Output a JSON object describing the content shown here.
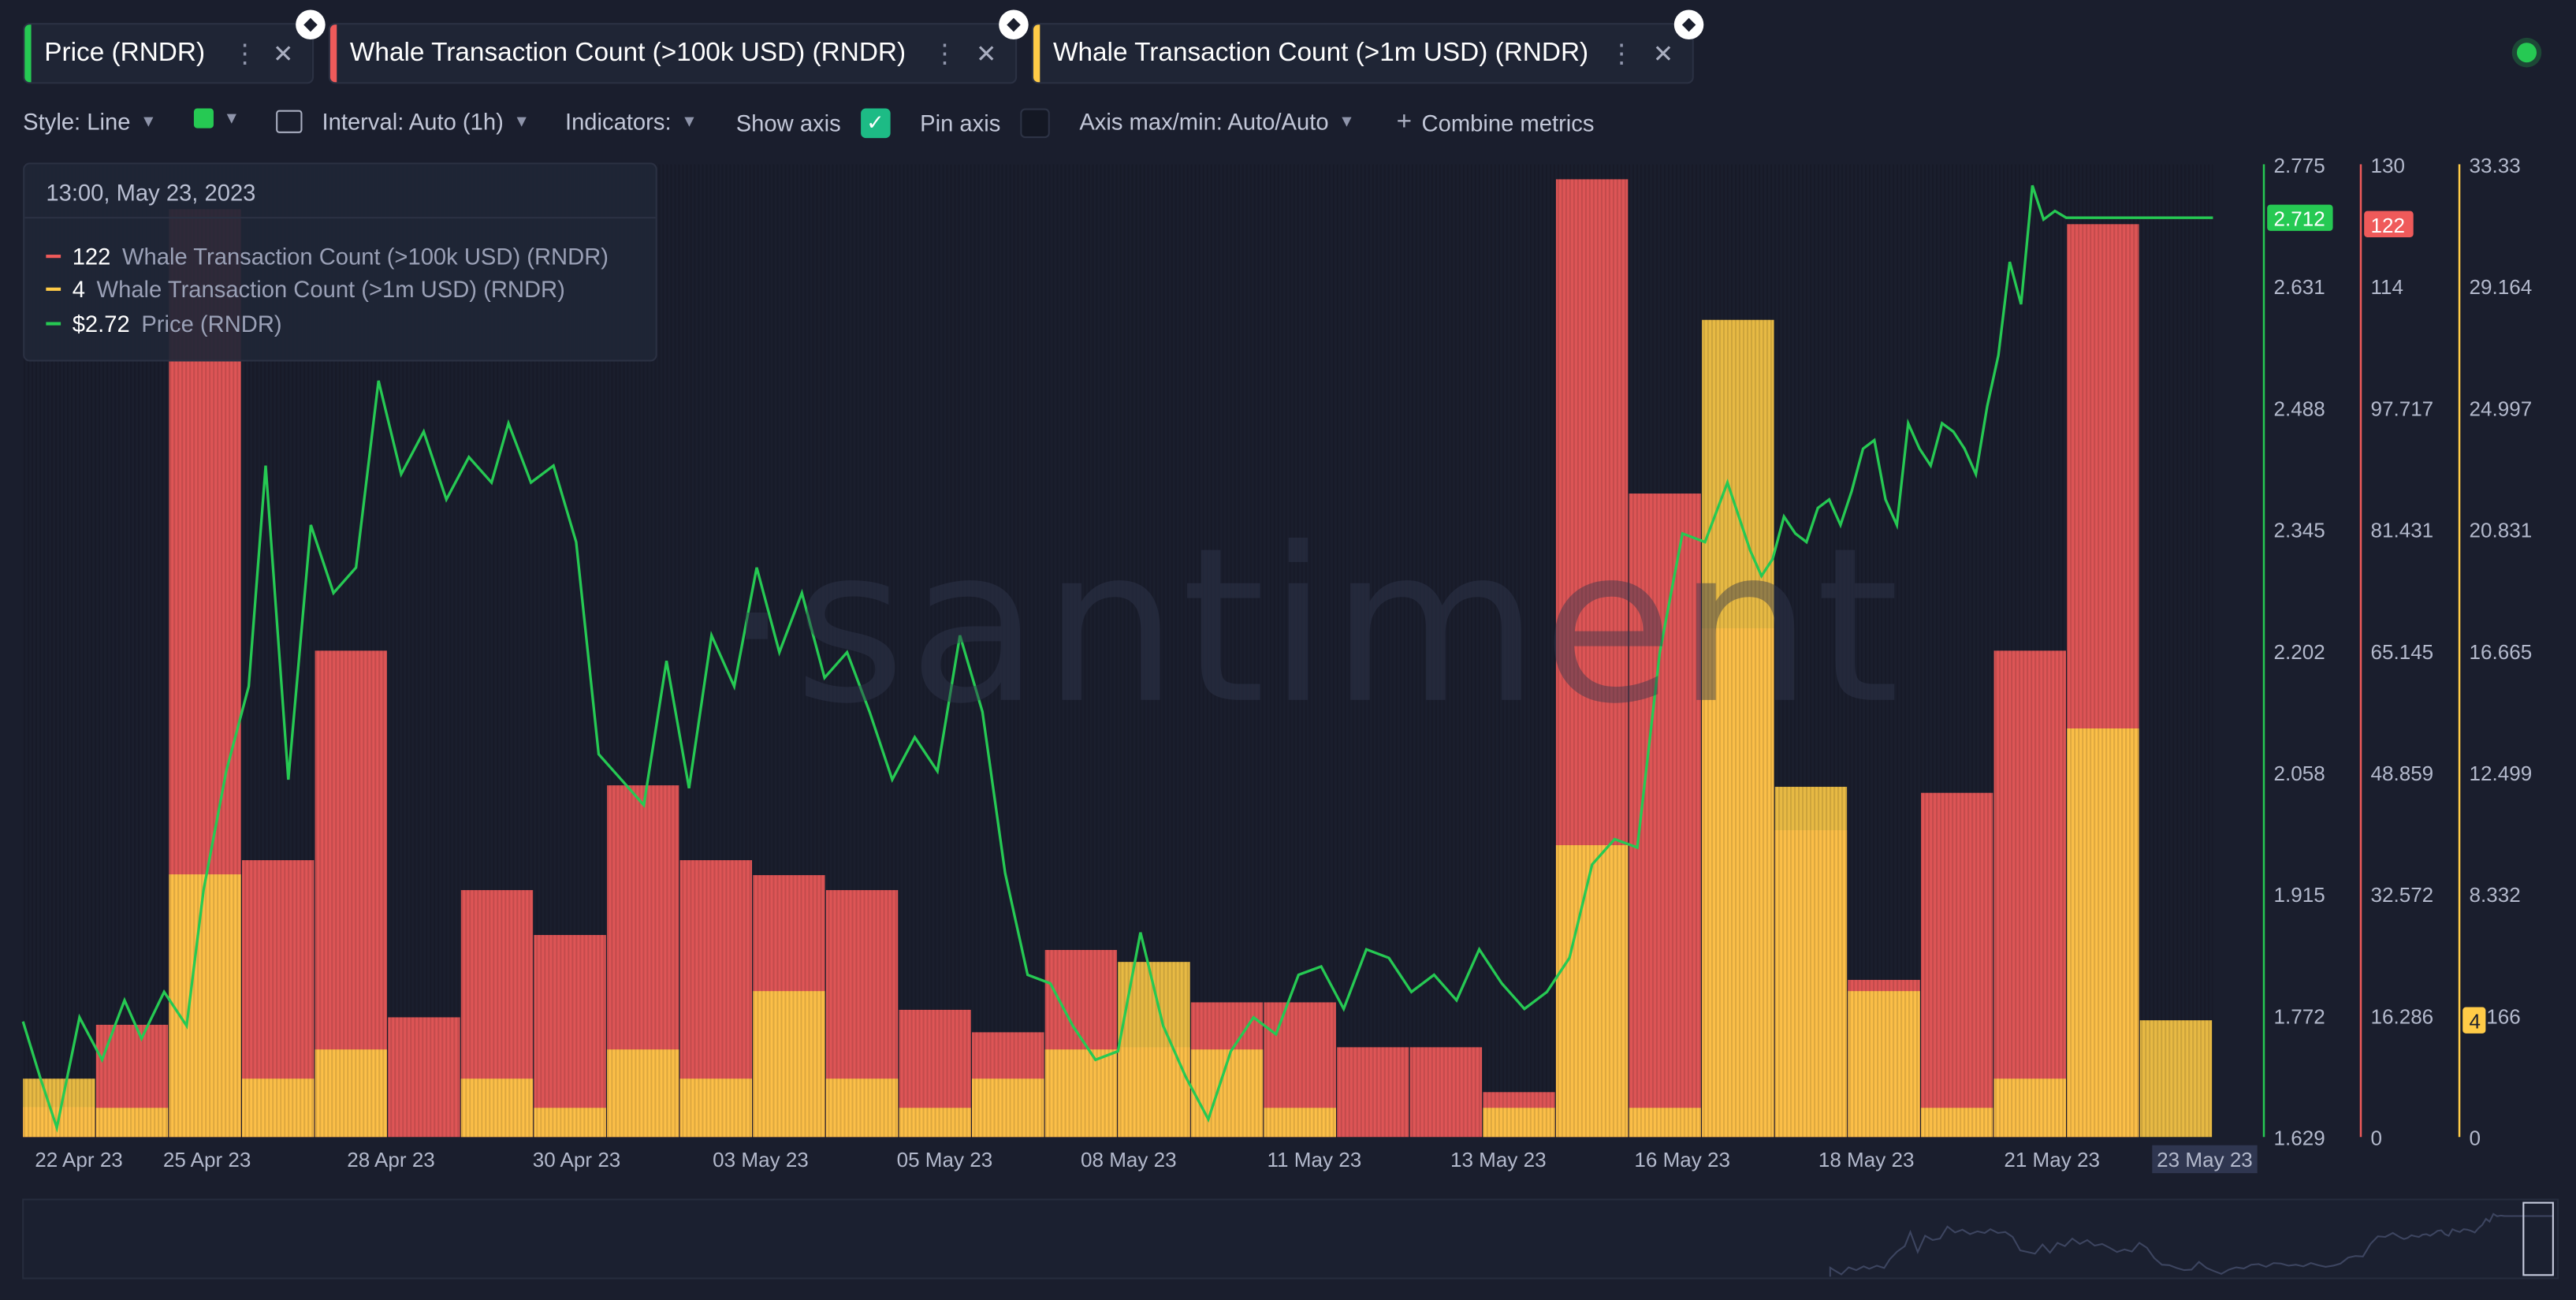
{
  "tabs": [
    {
      "label": "Price (RNDR)",
      "color": "#26c953"
    },
    {
      "label": "Whale Transaction Count (>100k USD) (RNDR)",
      "color": "#ef5a5a"
    },
    {
      "label": "Whale Transaction Count (>1m USD) (RNDR)",
      "color": "#ffcb47"
    }
  ],
  "toolbar": {
    "style": "Style: Line",
    "color_swatch": "#26c953",
    "interval": "Interval: Auto (1h)",
    "indicators": "Indicators:",
    "show_axis": "Show axis",
    "pin_axis": "Pin axis",
    "axis_maxmin": "Axis max/min: Auto/Auto",
    "combine": "Combine metrics"
  },
  "tooltip": {
    "datetime": "13:00, May 23, 2023",
    "rows": [
      {
        "value": "122",
        "name": "Whale Transaction Count (>100k USD) (RNDR)",
        "color": "#ef5a5a"
      },
      {
        "value": "4",
        "name": "Whale Transaction Count (>1m USD) (RNDR)",
        "color": "#ffcb47"
      },
      {
        "value": "$2.72",
        "name": "Price (RNDR)",
        "color": "#26c953"
      }
    ]
  },
  "watermark": "·santiment",
  "chart_data": {
    "type": "bar",
    "x_ticks": [
      "22 Apr 23",
      "25 Apr 23",
      "28 Apr 23",
      "30 Apr 23",
      "03 May 23",
      "05 May 23",
      "08 May 23",
      "11 May 23",
      "13 May 23",
      "16 May 23",
      "18 May 23",
      "21 May 23",
      "23 May 23"
    ],
    "axes": [
      {
        "name": "Price (RNDR)",
        "color": "#26c953",
        "ticks": [
          "2.775",
          "2.631",
          "2.488",
          "2.345",
          "2.202",
          "2.058",
          "1.915",
          "1.772",
          "1.629"
        ],
        "ylim": [
          1.629,
          2.775
        ],
        "current_label": "2.712"
      },
      {
        "name": "Whale Transaction Count (>100k USD) (RNDR)",
        "color": "#ef5a5a",
        "ticks": [
          "130",
          "114",
          "97.717",
          "81.431",
          "65.145",
          "48.859",
          "32.572",
          "16.286",
          "0"
        ],
        "ylim": [
          0,
          130
        ],
        "current_label": "122"
      },
      {
        "name": "Whale Transaction Count (>1m USD) (RNDR)",
        "color": "#ffcb47",
        "ticks": [
          "33.33",
          "29.164",
          "24.997",
          "20.831",
          "16.665",
          "12.499",
          "8.332",
          "4.166",
          "0"
        ],
        "ylim": [
          0,
          33.33
        ],
        "current_label": "4"
      }
    ],
    "series": [
      {
        "name": "Whale Transaction Count (>100k USD) (RNDR)",
        "color": "#ef5a5a",
        "values": [
          4,
          15,
          124,
          37,
          65,
          16,
          33,
          27,
          47,
          37,
          35,
          33,
          17,
          14,
          25,
          12,
          18,
          18,
          12,
          12,
          6,
          128,
          86,
          68,
          41,
          21,
          46,
          65,
          122
        ]
      },
      {
        "name": "Whale Transaction Count (>1m USD) (RNDR)",
        "color": "#ffcb47",
        "values": [
          2,
          1,
          9,
          2,
          3,
          0,
          2,
          1,
          3,
          2,
          5,
          2,
          1,
          2,
          3,
          6,
          3,
          1,
          0,
          0,
          1,
          10,
          1,
          28,
          12,
          5,
          1,
          2,
          14,
          4
        ]
      },
      {
        "name": "Price (RNDR)",
        "color": "#26c953",
        "x": [
          0.0,
          0.3,
          0.6,
          1.0,
          1.4,
          1.8,
          2.1,
          2.5,
          2.9,
          3.2,
          3.6,
          4.0,
          4.3,
          4.7,
          5.1,
          5.5,
          5.9,
          6.3,
          6.7,
          7.1,
          7.5,
          7.9,
          8.3,
          8.6,
          9.0,
          9.4,
          9.8,
          10.2,
          10.6,
          11.0,
          11.4,
          11.8,
          12.2,
          12.6,
          13.0,
          13.4,
          13.8,
          14.2,
          14.6,
          15.0,
          15.4,
          15.8,
          16.2,
          16.6,
          17.0,
          17.4,
          17.8,
          18.2,
          18.6,
          19.0,
          19.4,
          19.8,
          20.2,
          20.6,
          21.0,
          21.4,
          21.8,
          22.2,
          22.6,
          23.0,
          23.4,
          23.8,
          24.2,
          24.6,
          25.0,
          25.4,
          25.8,
          26.2,
          26.6,
          27.0,
          27.4,
          27.8,
          28.2,
          28.6,
          29.0,
          29.4,
          29.8,
          30.2,
          30.6,
          30.8,
          31.0,
          31.2,
          31.4,
          31.6,
          31.8,
          32.0,
          32.2,
          32.4,
          32.6,
          32.8,
          33.0,
          33.2,
          33.4,
          33.6,
          33.8,
          34.0,
          34.2,
          34.4,
          34.6,
          34.8,
          35.0,
          35.2,
          35.4,
          35.6,
          35.8,
          36.0,
          36.2,
          36.4,
          36.6,
          36.8,
          37.0,
          37.2,
          37.4,
          37.6,
          37.8,
          38.0,
          38.2,
          38.4,
          38.6,
          38.8
        ],
        "values": [
          1.765,
          1.7,
          1.64,
          1.77,
          1.72,
          1.79,
          1.745,
          1.8,
          1.76,
          1.92,
          2.06,
          2.16,
          2.42,
          2.05,
          2.35,
          2.27,
          2.3,
          2.52,
          2.41,
          2.46,
          2.38,
          2.43,
          2.4,
          2.47,
          2.4,
          2.42,
          2.33,
          2.08,
          2.05,
          2.02,
          2.19,
          2.04,
          2.22,
          2.16,
          2.3,
          2.2,
          2.27,
          2.17,
          2.2,
          2.13,
          2.05,
          2.1,
          2.06,
          2.22,
          2.13,
          1.94,
          1.82,
          1.81,
          1.76,
          1.72,
          1.73,
          1.87,
          1.76,
          1.7,
          1.65,
          1.73,
          1.77,
          1.75,
          1.82,
          1.83,
          1.78,
          1.85,
          1.84,
          1.8,
          1.82,
          1.79,
          1.85,
          1.81,
          1.78,
          1.8,
          1.84,
          1.95,
          1.98,
          1.97,
          2.2,
          2.34,
          2.33,
          2.4,
          2.32,
          2.29,
          2.31,
          2.36,
          2.34,
          2.33,
          2.37,
          2.38,
          2.35,
          2.39,
          2.44,
          2.45,
          2.38,
          2.35,
          2.47,
          2.44,
          2.42,
          2.47,
          2.46,
          2.44,
          2.41,
          2.49,
          2.55,
          2.66,
          2.61,
          2.75,
          2.71,
          2.72,
          2.712,
          2.712,
          2.712,
          2.712,
          2.712,
          2.712,
          2.712,
          2.712,
          2.712,
          2.712,
          2.712,
          2.712,
          2.712,
          2.712
        ]
      }
    ]
  }
}
